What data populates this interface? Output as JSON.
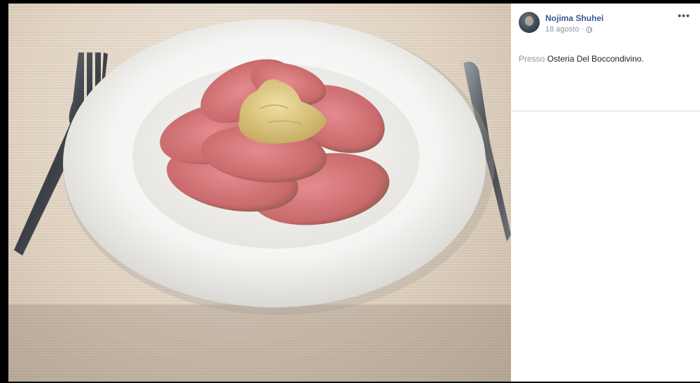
{
  "photo": {
    "alt_semantic": "food-photo"
  },
  "post": {
    "author": "Nojima Shuhei",
    "date": "18 agosto",
    "separator": "·",
    "more_label": "•••",
    "location_prefix": "Presso",
    "location_name": "Osteria Del Boccondivino."
  },
  "colors": {
    "author_link": "#385898",
    "meta_gray": "#90949c",
    "divider": "#dddfe2"
  }
}
